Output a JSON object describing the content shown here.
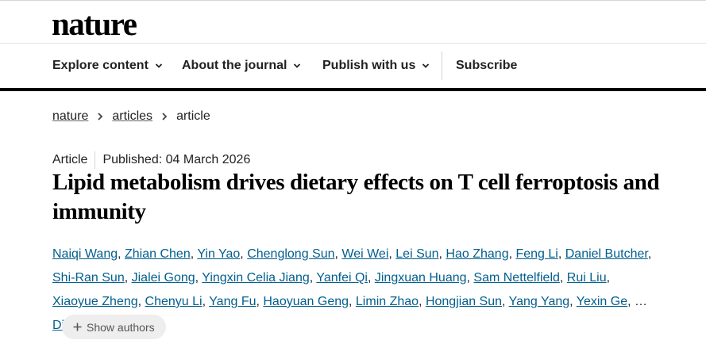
{
  "header": {
    "logo_text": "nature"
  },
  "nav": {
    "items": [
      {
        "label": "Explore content"
      },
      {
        "label": "About the journal"
      },
      {
        "label": "Publish with us"
      }
    ],
    "subscribe_label": "Subscribe"
  },
  "breadcrumb": {
    "items": [
      "nature",
      "articles"
    ],
    "current": "article"
  },
  "article": {
    "type": "Article",
    "published": "Published: 04 March 2026",
    "title": "Lipid metabolism drives dietary effects on T cell ferroptosis and immunity",
    "authors": [
      "Naiqi Wang",
      "Zhian Chen",
      "Yin Yao",
      "Chenglong Sun",
      "Wei Wei",
      "Lei Sun",
      "Hao Zhang",
      "Feng Li",
      "Daniel Butcher",
      "Shi-Ran Sun",
      "Jialei Gong",
      "Yingxin Celia Jiang",
      "Yanfei Qi",
      "Jingxuan Huang",
      "Sam Nettelfield",
      "Rui Liu",
      "Xiaoyue Zheng",
      "Chenyu Li",
      "Yang Fu",
      "Haoyuan Geng",
      "Limin Zhao",
      "Hongjian Sun",
      "Yang Yang",
      "Yexin Ge"
    ],
    "ellipsis": "…",
    "last_author": "Di Yu",
    "show_authors_label": "Show authors"
  },
  "colors": {
    "link": "#025e8d",
    "text": "#222222",
    "pill_bg": "#eeeeee",
    "nav_rule": "#000000"
  },
  "icons": {
    "nav_chevron": "chevron-down-icon",
    "breadcrumb_sep": "chevron-right-icon",
    "contact": "mail-icon",
    "expand": "plus-icon"
  }
}
